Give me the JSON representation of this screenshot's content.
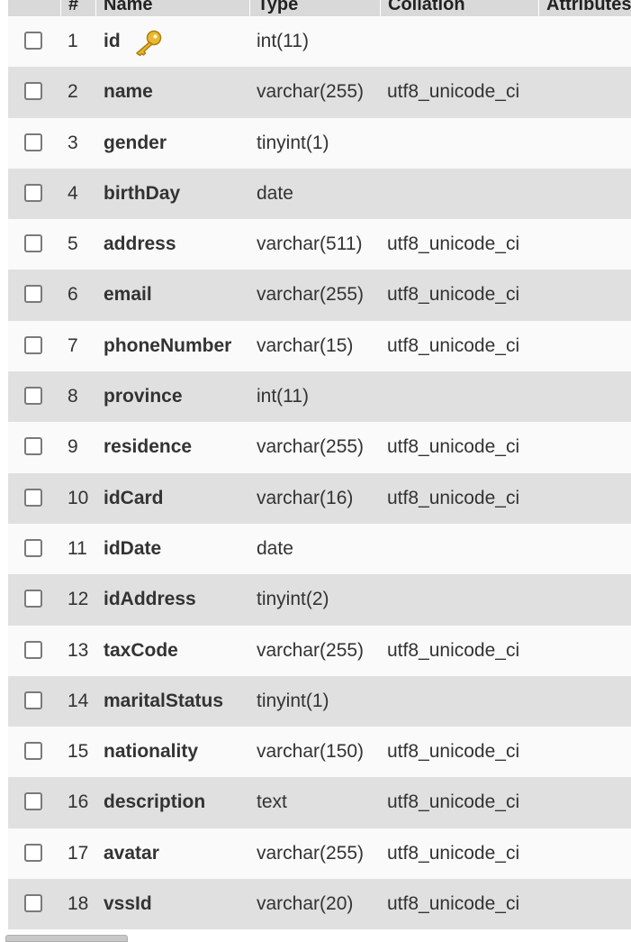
{
  "header": {
    "columns": [
      "#",
      "Name",
      "Type",
      "Collation",
      "Attributes"
    ]
  },
  "rows": [
    {
      "num": "1",
      "name": "id",
      "type": "int(11)",
      "collation": "",
      "primary_key": true
    },
    {
      "num": "2",
      "name": "name",
      "type": "varchar(255)",
      "collation": "utf8_unicode_ci"
    },
    {
      "num": "3",
      "name": "gender",
      "type": "tinyint(1)",
      "collation": ""
    },
    {
      "num": "4",
      "name": "birthDay",
      "type": "date",
      "collation": ""
    },
    {
      "num": "5",
      "name": "address",
      "type": "varchar(511)",
      "collation": "utf8_unicode_ci"
    },
    {
      "num": "6",
      "name": "email",
      "type": "varchar(255)",
      "collation": "utf8_unicode_ci"
    },
    {
      "num": "7",
      "name": "phoneNumber",
      "type": "varchar(15)",
      "collation": "utf8_unicode_ci"
    },
    {
      "num": "8",
      "name": "province",
      "type": "int(11)",
      "collation": ""
    },
    {
      "num": "9",
      "name": "residence",
      "type": "varchar(255)",
      "collation": "utf8_unicode_ci"
    },
    {
      "num": "10",
      "name": "idCard",
      "type": "varchar(16)",
      "collation": "utf8_unicode_ci"
    },
    {
      "num": "11",
      "name": "idDate",
      "type": "date",
      "collation": ""
    },
    {
      "num": "12",
      "name": "idAddress",
      "type": "tinyint(2)",
      "collation": ""
    },
    {
      "num": "13",
      "name": "taxCode",
      "type": "varchar(255)",
      "collation": "utf8_unicode_ci"
    },
    {
      "num": "14",
      "name": "maritalStatus",
      "type": "tinyint(1)",
      "collation": ""
    },
    {
      "num": "15",
      "name": "nationality",
      "type": "varchar(150)",
      "collation": "utf8_unicode_ci"
    },
    {
      "num": "16",
      "name": "description",
      "type": "text",
      "collation": "utf8_unicode_ci"
    },
    {
      "num": "17",
      "name": "avatar",
      "type": "varchar(255)",
      "collation": "utf8_unicode_ci"
    },
    {
      "num": "18",
      "name": "vssId",
      "type": "varchar(20)",
      "collation": "utf8_unicode_ci"
    }
  ],
  "icons": {
    "primary_key": "key-icon",
    "row_select": "checkbox-icon"
  },
  "colors": {
    "row_odd": "#fafafa",
    "row_even": "#e0e0e0",
    "header": "#d9d9d9",
    "key_gold": "#e8b830"
  }
}
